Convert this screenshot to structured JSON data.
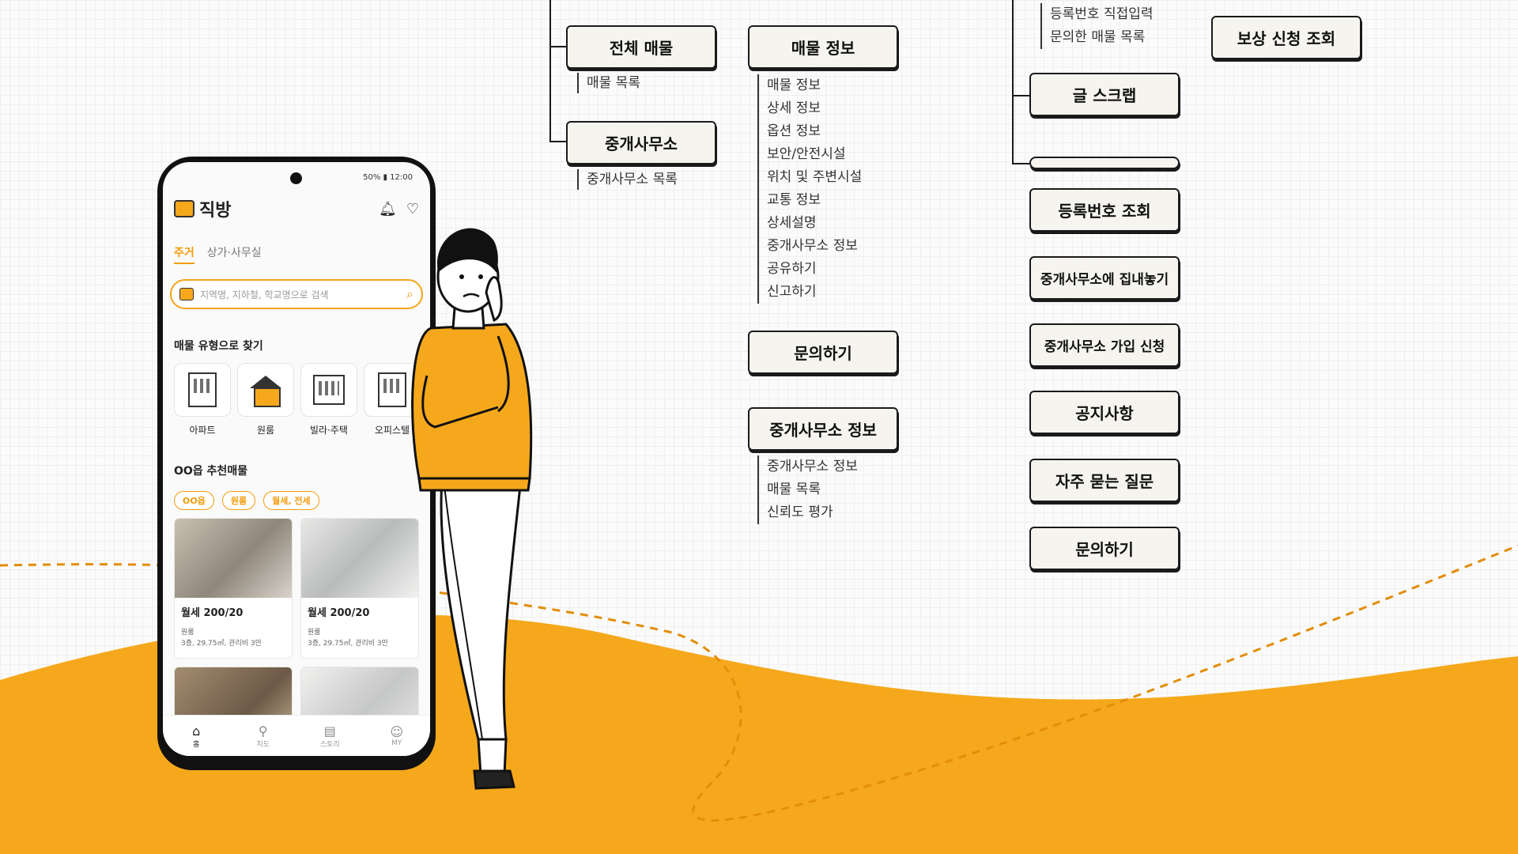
{
  "sitemap": {
    "col1": {
      "all_listings": {
        "label": "전체 매물",
        "items": [
          "매물 목록"
        ]
      },
      "agencies": {
        "label": "중개사무소",
        "items": [
          "중개사무소 목록"
        ]
      }
    },
    "col2": {
      "listing_info": {
        "label": "매물 정보",
        "items": [
          "매물 정보",
          "상세 정보",
          "옵션 정보",
          "보안/안전시설",
          "위치 및 주변시설",
          "교통 정보",
          "상세설명",
          "중개사무소 정보",
          "공유하기",
          "신고하기"
        ]
      },
      "inquiry": {
        "label": "문의하기"
      },
      "agency_info": {
        "label": "중개사무소 정보",
        "items": [
          "중개사무소 정보",
          "매물 목록",
          "신뢰도 평가"
        ]
      }
    },
    "col3": {
      "top_items": [
        "등록번호 직접입력",
        "문의한 매물 목록"
      ],
      "scrap": "글 스크랩",
      "empty": "",
      "reg_lookup": "등록번호 조회",
      "list_with_agency": "중개사무소에 집내놓기",
      "agency_signup": "중개사무소 가입 신청",
      "notice": "공지사항",
      "faq": "자주 묻는 질문",
      "inquiry": "문의하기"
    },
    "col4": {
      "comp_lookup": "보상 신청 조회"
    }
  },
  "phone": {
    "status": "50% ▮ 12:00",
    "app_name": "직방",
    "tabs": [
      "주거",
      "상가·사무실"
    ],
    "search_placeholder": "지역명, 지하철, 학교명으로 검색",
    "type_section_title": "매물 유형으로 찾기",
    "types": [
      "아파트",
      "원룸",
      "빌라·주택",
      "오피스텔"
    ],
    "recommend_title": "OO읍 추천매물",
    "chips": [
      "OO읍",
      "원룸",
      "월세, 전세"
    ],
    "cards": [
      {
        "price": "월세 200/20",
        "kind": "원룸",
        "detail": "3층, 29.75㎡, 관리비 3만"
      },
      {
        "price": "월세 200/20",
        "kind": "원룸",
        "detail": "3층, 29.75㎡, 관리비 3만"
      }
    ],
    "nav": [
      "홈",
      "지도",
      "스토리",
      "MY"
    ]
  },
  "colors": {
    "accent": "#F4A41A",
    "line": "#1A1A1A"
  }
}
